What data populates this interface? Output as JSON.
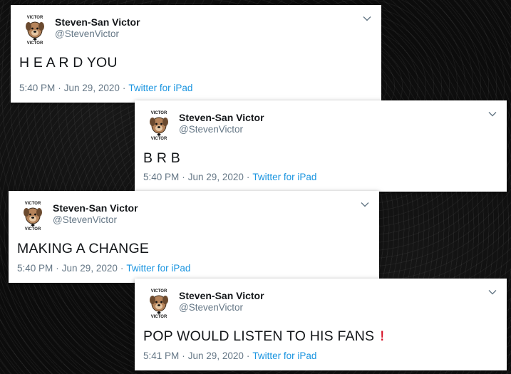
{
  "tweets": [
    {
      "display_name": "Steven-San Victor",
      "handle": "@StevenVictor",
      "text": "H E A R D YOU",
      "time": "5:40 PM",
      "date": "Jun 29, 2020",
      "source": "Twitter for iPad"
    },
    {
      "display_name": "Steven-San Victor",
      "handle": "@StevenVictor",
      "text": "B R B",
      "time": "5:40 PM",
      "date": "Jun 29, 2020",
      "source": "Twitter for iPad"
    },
    {
      "display_name": "Steven-San Victor",
      "handle": "@StevenVictor",
      "text": "MAKING A CHANGE",
      "time": "5:40 PM",
      "date": "Jun 29, 2020",
      "source": "Twitter for iPad"
    },
    {
      "display_name": "Steven-San Victor",
      "handle": "@StevenVictor",
      "text": "POP WOULD LISTEN TO HIS FANS",
      "emoji": "!",
      "time": "5:41 PM",
      "date": "Jun 29, 2020",
      "source": "Twitter for iPad"
    }
  ],
  "avatar": {
    "top_text": "VICTOR",
    "bottom_text": "VICTOR",
    "icon": "dog-face-icon"
  },
  "colors": {
    "background": "#0c0c0c",
    "card": "#ffffff",
    "name": "#14171a",
    "secondary": "#657786",
    "link": "#1b95e0",
    "emoji_red": "#d50e24"
  }
}
